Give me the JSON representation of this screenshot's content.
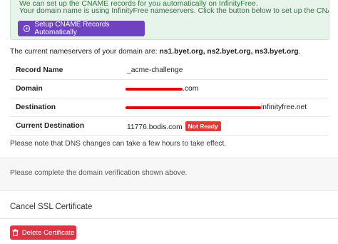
{
  "alert": {
    "top_text": "We can set up the CNAME records for you automatically on InfinityFree.",
    "body_text": "Your domain name is using InfinityFree nameservers. Click the button below to set up the CNAME record.",
    "setup_button_label": "Setup CNAME Records Automatically"
  },
  "nameservers": {
    "prefix": "The current nameservers of your domain are: ",
    "list": "ns1.byet.org, ns2.byet.org, ns3.byet.org",
    "suffix": "."
  },
  "record": {
    "rows": [
      {
        "label": "Record Name",
        "value": "_acme-challenge"
      },
      {
        "label": "Domain",
        "value": ".com"
      },
      {
        "label": "Destination",
        "value": "infinityfree.net"
      },
      {
        "label": "Current Destination",
        "value": "11776.bodis.com",
        "badge": "Not Ready"
      }
    ]
  },
  "dns_note": "Please note that DNS changes can take a few hours to take effect.",
  "verification_note": "Please complete the domain verification shown above.",
  "cancel": {
    "title": "Cancel SSL Certificate",
    "delete_button_label": "Delete Certificate"
  },
  "colors": {
    "primary_purple": "#6f42c1",
    "danger_red": "#dc3545",
    "badge_red": "#e53935",
    "alert_green_bg": "#e6f4ea"
  }
}
